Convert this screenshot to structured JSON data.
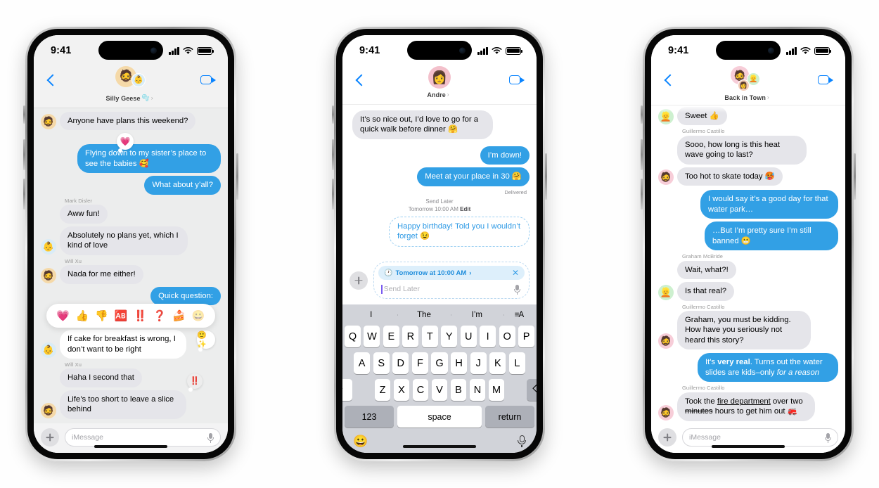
{
  "status_bar": {
    "time": "9:41",
    "signal_icon": "cellular-bars-icon",
    "wifi_icon": "wifi-icon",
    "battery_icon": "battery-full-icon"
  },
  "phone1": {
    "nav": {
      "back_icon": "back-chevron-icon",
      "title": "Silly Geese",
      "title_emoji": "🫧",
      "chevron": "›",
      "facetime_icon": "facetime-video-icon"
    },
    "avatars": [
      {
        "emoji": "🧔",
        "bg": "#f5d9a8"
      },
      {
        "emoji": "👶",
        "bg": "#d9ecf7"
      }
    ],
    "messages": [
      {
        "side": "in",
        "text": "Anyone have plans this weekend?",
        "avatar": "🧔",
        "avatar_bg": "#f5d9a8",
        "tail": true
      },
      {
        "side": "out",
        "text": "Flying down to my sister’s place to see the babies 🥰",
        "tail": false,
        "tapback": "💗"
      },
      {
        "side": "out",
        "text": "What about y’all?",
        "tail": true
      },
      {
        "sender": "Mark Disler"
      },
      {
        "side": "in",
        "text": "Aww fun!",
        "avatar": null
      },
      {
        "side": "in",
        "text": "Absolutely no plans yet, which I kind of love",
        "avatar": "👶",
        "avatar_bg": "#d9ecf7",
        "tail": true
      },
      {
        "sender": "Will Xu"
      },
      {
        "side": "in",
        "text": "Nada for me either!",
        "avatar": "🧔",
        "avatar_bg": "#f5d9a8",
        "tail": true
      },
      {
        "side": "out",
        "text": "Quick question:",
        "tail": false
      },
      {
        "side": "in",
        "text": "If cake for breakfast is wrong, I don’t want to be right",
        "avatar": "👶",
        "avatar_bg": "#d9ecf7",
        "tail": true,
        "white": true,
        "tapback": "🙂✨"
      },
      {
        "sender": "Will Xu"
      },
      {
        "side": "in",
        "text": "Haha I second that",
        "avatar": null,
        "tapback": "‼️"
      },
      {
        "side": "in",
        "text": "Life’s too short to leave a slice behind",
        "avatar": "🧔",
        "avatar_bg": "#f5d9a8",
        "tail": true
      }
    ],
    "tapback_bar": [
      "💗",
      "👍",
      "👎",
      "🆎",
      "‼️",
      "❓",
      "🍰",
      "😀"
    ],
    "composer": {
      "plus_icon": "plus-icon",
      "placeholder": "iMessage",
      "mic_icon": "microphone-icon"
    }
  },
  "phone2": {
    "nav": {
      "back_icon": "back-chevron-icon",
      "title": "Andre",
      "chevron": "›",
      "facetime_icon": "facetime-video-icon"
    },
    "avatars": [
      {
        "emoji": "👩",
        "bg": "#f3c0cb"
      }
    ],
    "messages": [
      {
        "side": "in",
        "text": "It’s so nice out, I’d love to go for a quick walk before dinner 🤗",
        "tail": true
      },
      {
        "side": "out",
        "text": "I’m down!",
        "tail": false
      },
      {
        "side": "out",
        "text": "Meet at your place in 30 🤗",
        "tail": true
      }
    ],
    "delivered_label": "Delivered",
    "send_later": {
      "label": "Send Later",
      "time": "Tomorrow 10:00 AM",
      "edit": "Edit"
    },
    "scheduled_message": "Happy birthday! Told you I wouldn’t forget 😉",
    "composer": {
      "plus_icon": "plus-icon",
      "chip_clock_icon": "clock-icon",
      "chip_text": "Tomorrow at 10:00 AM",
      "chip_chevron": "›",
      "chip_close_icon": "close-x-icon",
      "placeholder": "Send Later",
      "mic_icon": "microphone-icon"
    },
    "keyboard": {
      "predictions": [
        "I",
        "The",
        "I’m"
      ],
      "format_icon": "text-format-icon",
      "row1": [
        "Q",
        "W",
        "E",
        "R",
        "T",
        "Y",
        "U",
        "I",
        "O",
        "P"
      ],
      "row2": [
        "A",
        "S",
        "D",
        "F",
        "G",
        "H",
        "J",
        "K",
        "L"
      ],
      "row3": [
        "Z",
        "X",
        "C",
        "V",
        "B",
        "N",
        "M"
      ],
      "shift_icon": "shift-up-icon",
      "backspace_icon": "backspace-icon",
      "numbers_key": "123",
      "space_key": "space",
      "return_key": "return",
      "emoji_icon": "emoji-smiley-icon",
      "dictation_icon": "microphone-icon"
    }
  },
  "phone3": {
    "nav": {
      "back_icon": "back-chevron-icon",
      "title": "Back in Town",
      "chevron": "›",
      "facetime_icon": "facetime-video-icon"
    },
    "avatars": [
      {
        "emoji": "🧔",
        "bg": "#f7cdd8"
      },
      {
        "emoji": "👱",
        "bg": "#cdf0cf"
      },
      {
        "emoji": "👩",
        "bg": "#f2cbb6"
      }
    ],
    "messages": [
      {
        "side": "in",
        "text": "Sweet 👍",
        "avatar": "👱",
        "avatar_bg": "#cdf0cf",
        "tail": true
      },
      {
        "sender": "Guillermo Castillo"
      },
      {
        "side": "in",
        "text": "Sooo, how long is this heat wave going to last?",
        "avatar": null
      },
      {
        "side": "in",
        "text": "Too hot to skate today 🥵",
        "avatar": "🧔",
        "avatar_bg": "#f7cdd8",
        "tail": true
      },
      {
        "side": "out",
        "text": "I would say it’s a good day for that water park…",
        "tail": false
      },
      {
        "side": "out",
        "text": "…But I’m pretty sure I’m still banned 😬",
        "tail": true
      },
      {
        "sender": "Graham McBride"
      },
      {
        "side": "in",
        "text": "Wait, what?!",
        "avatar": null
      },
      {
        "side": "in",
        "text": "Is that real?",
        "avatar": "👱",
        "avatar_bg": "#cdf0cf",
        "tail": true
      },
      {
        "sender": "Guillermo Castillo"
      },
      {
        "side": "in",
        "text": "Graham, you must be kidding. How have you seriously not heard this story?",
        "avatar": "🧔",
        "avatar_bg": "#f7cdd8",
        "tail": true
      },
      {
        "side": "out",
        "html": "It's <b>very real</b>. Turns out the water slides are kids–only <i>for a reason</i>",
        "tail": true
      },
      {
        "sender": "Guillermo Castillo"
      },
      {
        "side": "in",
        "html": "Took the <u>fire department</u> over two <s>minutes</s> hours to get him out 🚒",
        "avatar": "🧔",
        "avatar_bg": "#f7cdd8",
        "tail": true
      }
    ],
    "composer": {
      "plus_icon": "plus-icon",
      "placeholder": "iMessage",
      "mic_icon": "microphone-icon"
    }
  },
  "colors": {
    "bubble_out": "#32a0e5",
    "bubble_in": "#e5e5ea",
    "accent_blue": "#0a84ff",
    "thread_gray": "#eceded"
  }
}
